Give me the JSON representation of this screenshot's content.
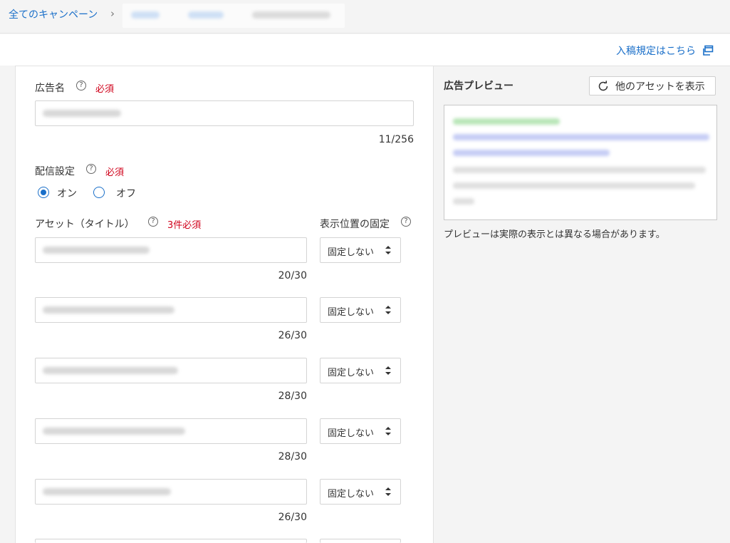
{
  "breadcrumb": {
    "all_campaigns": "全てのキャンペーン",
    "separator": "›"
  },
  "rules_link": "入稿規定はこちら",
  "ad_name": {
    "label": "広告名",
    "required": "必須",
    "counter": "11/256"
  },
  "delivery": {
    "label": "配信設定",
    "required": "必須",
    "on": "オン",
    "off": "オフ",
    "selected": "on"
  },
  "assets": {
    "label": "アセット（タイトル）",
    "required": "3件必須",
    "position_label": "表示位置の固定",
    "items": [
      {
        "counter": "20/30",
        "position": "固定しない"
      },
      {
        "counter": "26/30",
        "position": "固定しない"
      },
      {
        "counter": "28/30",
        "position": "固定しない"
      },
      {
        "counter": "28/30",
        "position": "固定しない"
      },
      {
        "counter": "26/30",
        "position": "固定しない"
      }
    ]
  },
  "preview": {
    "title": "広告プレビュー",
    "other_button": "他のアセットを表示",
    "note": "プレビューは実際の表示とは異なる場合があります。"
  },
  "colors": {
    "link": "#1a6fc9",
    "required": "#d0021b"
  }
}
